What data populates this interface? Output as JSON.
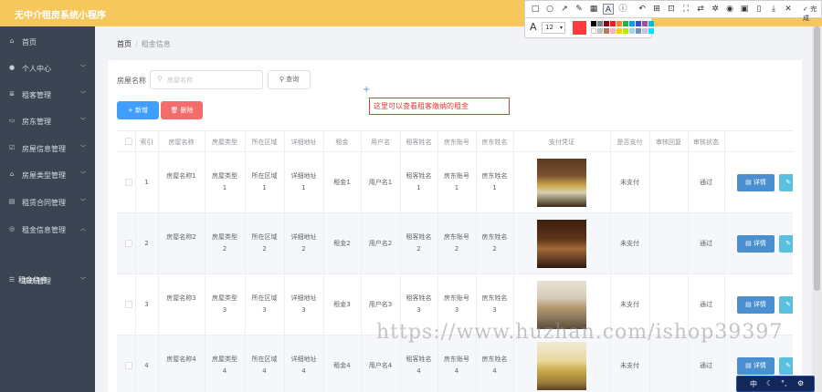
{
  "app": {
    "title": "无中介租房系统小程序"
  },
  "sidebar": {
    "items": [
      {
        "label": "首页",
        "icon": "home-icon",
        "glyph": "⌂",
        "has_chevron": false
      },
      {
        "label": "个人中心",
        "icon": "user-icon",
        "glyph": "●",
        "has_chevron": true
      },
      {
        "label": "租客管理",
        "icon": "list-icon",
        "glyph": "≣",
        "has_chevron": true
      },
      {
        "label": "房东管理",
        "icon": "folder-icon",
        "glyph": "▭",
        "has_chevron": true
      },
      {
        "label": "房屋信息管理",
        "icon": "info-icon",
        "glyph": "☑",
        "has_chevron": true
      },
      {
        "label": "房屋类型管理",
        "icon": "house-icon",
        "glyph": "⌂",
        "has_chevron": true
      },
      {
        "label": "租赁合同管理",
        "icon": "contract-icon",
        "glyph": "▤",
        "has_chevron": true
      },
      {
        "label": "租金信息管理",
        "icon": "money-icon",
        "glyph": "◎",
        "has_chevron": true
      },
      {
        "label": "系统管理",
        "icon": "settings-icon",
        "glyph": "☰",
        "has_chevron": true
      }
    ],
    "active_sub": "租金信息"
  },
  "breadcrumb": {
    "home": "首页",
    "separator": "/",
    "current": "租金信息"
  },
  "search": {
    "label": "房屋名称",
    "placeholder": "房屋名称",
    "button": "查询"
  },
  "actions": {
    "add": "+ 新增",
    "delete": "删除"
  },
  "annotation": {
    "text": "这里可以查看租客缴纳的租金"
  },
  "table": {
    "headers": [
      "索引",
      "房屋名称",
      "房屋类型",
      "所在区域",
      "详细地址",
      "租金",
      "用户名",
      "租客姓名",
      "房东账号",
      "房东姓名",
      "支付凭证",
      "是否支付",
      "审核回复",
      "审核状态"
    ],
    "rows": [
      {
        "index": "1",
        "name": "房屋名称1",
        "type": "房屋类型1",
        "area": "所在区域1",
        "address": "详细地址1",
        "rent": "租金1",
        "user": "用户名1",
        "tenant": "租客姓名1",
        "landlord_acct": "房东账号1",
        "landlord": "房东姓名1",
        "paid": "未支付",
        "reply": "",
        "status": "通过",
        "detail": "详情"
      },
      {
        "index": "2",
        "name": "房屋名称2",
        "type": "房屋类型2",
        "area": "所在区域2",
        "address": "详细地址2",
        "rent": "租金2",
        "user": "用户名2",
        "tenant": "租客姓名2",
        "landlord_acct": "房东账号2",
        "landlord": "房东姓名2",
        "paid": "未支付",
        "reply": "",
        "status": "通过",
        "detail": "详情"
      },
      {
        "index": "3",
        "name": "房屋名称3",
        "type": "房屋类型3",
        "area": "所在区域3",
        "address": "详细地址3",
        "rent": "租金3",
        "user": "用户名3",
        "tenant": "租客姓名3",
        "landlord_acct": "房东账号3",
        "landlord": "房东姓名3",
        "paid": "未支付",
        "reply": "",
        "status": "通过",
        "detail": "详情"
      },
      {
        "index": "4",
        "name": "房屋名称4",
        "type": "房屋类型4",
        "area": "所在区域4",
        "address": "详细地址4",
        "rent": "租金4",
        "user": "用户名4",
        "tenant": "租客姓名4",
        "landlord_acct": "房东账号4",
        "landlord": "房东姓名4",
        "paid": "未支付",
        "reply": "",
        "status": "通过",
        "detail": "详情"
      }
    ]
  },
  "screenshot_tool": {
    "done_label": "完成",
    "font_size": "12",
    "current_color": "#ff3b3b"
  },
  "watermark": "https://www.huzhan.com/ishop39397",
  "ime": {
    "lang": "中"
  },
  "colors": {
    "header": "#f6c75d",
    "sidebar": "#3a4453",
    "primary": "#409eff",
    "danger": "#f56c6c"
  }
}
